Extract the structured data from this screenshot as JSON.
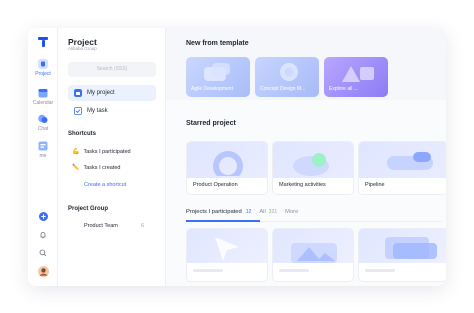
{
  "colors": {
    "accent": "#3a6ff7",
    "active_bg": "#ecf1fe"
  },
  "rail": {
    "items": [
      {
        "label": "Project",
        "icon": "project-icon",
        "active": true
      },
      {
        "label": "Calendar",
        "icon": "calendar-icon",
        "active": false
      },
      {
        "label": "Chat",
        "icon": "chat-icon",
        "active": false
      },
      {
        "label": "me",
        "icon": "me-icon",
        "active": false
      }
    ]
  },
  "panel": {
    "title": "Project",
    "subtitle": "Alibaba Group",
    "search_placeholder": "Search (SSS)",
    "nav": [
      {
        "label": "My project",
        "icon": "folder-icon"
      },
      {
        "label": "My task",
        "icon": "check-icon"
      }
    ],
    "shortcuts_title": "Shortcuts",
    "shortcuts": [
      {
        "label": "Tasks I participated",
        "icon": "muscle-icon",
        "glyph": "💪"
      },
      {
        "label": "Tasks I created",
        "icon": "pencil-icon",
        "glyph": "✏️"
      }
    ],
    "create_shortcut": "Create a shortcut",
    "group_title": "Project Group",
    "team": {
      "label": "Product Team",
      "count": "6"
    }
  },
  "main": {
    "template_title": "New from template",
    "templates": [
      {
        "label": "Agile Development"
      },
      {
        "label": "Concept Design M..."
      },
      {
        "label": "Explore all ..."
      }
    ],
    "starred_title": "Starred project",
    "starred": [
      {
        "label": "Product Operation"
      },
      {
        "label": "Marketing activities"
      },
      {
        "label": "Pipeline"
      }
    ],
    "tabs": [
      {
        "label": "Projects I participated",
        "count": "12",
        "active": true
      },
      {
        "label": "All",
        "count": "321",
        "active": false
      },
      {
        "label": "More",
        "count": "",
        "active": false
      }
    ]
  }
}
